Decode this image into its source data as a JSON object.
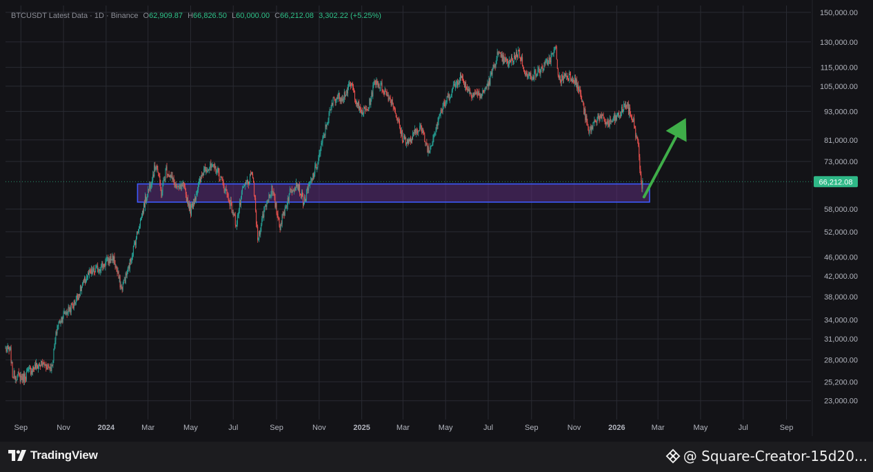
{
  "legend": {
    "symbol": "BTCUSDT Latest Data",
    "interval": "1D",
    "exchange": "Binance",
    "open_label": "O",
    "open": "62,909.87",
    "high_label": "H",
    "high": "66,826.50",
    "low_label": "L",
    "low": "60,000.00",
    "close_label": "C",
    "close": "66,212.08",
    "change": "3,302.22 (+5.25%)"
  },
  "colors": {
    "background": "#131317",
    "grid": "#2a2b33",
    "axis_text": "#b2b5be",
    "up": "#26a69a",
    "down": "#ef5350",
    "zone_fill": "#5b2d7a",
    "zone_border": "#3d5afe",
    "arrow": "#3fae49",
    "price_label_bg": "#2fb887"
  },
  "chart_data": {
    "type": "candlestick",
    "title": "BTCUSDT Latest Data · 1D · Binance",
    "y_scale": "log",
    "ylim": [
      21000,
      155000
    ],
    "grid": true,
    "x_ticks": [
      {
        "label": "Sep",
        "date": "2023-09-01",
        "bold": false
      },
      {
        "label": "Nov",
        "date": "2023-11-01",
        "bold": false
      },
      {
        "label": "2024",
        "date": "2024-01-01",
        "bold": true
      },
      {
        "label": "Mar",
        "date": "2024-03-01",
        "bold": false
      },
      {
        "label": "May",
        "date": "2024-05-01",
        "bold": false
      },
      {
        "label": "Jul",
        "date": "2024-07-01",
        "bold": false
      },
      {
        "label": "Sep",
        "date": "2024-09-01",
        "bold": false
      },
      {
        "label": "Nov",
        "date": "2024-11-01",
        "bold": false
      },
      {
        "label": "2025",
        "date": "2025-01-01",
        "bold": true
      },
      {
        "label": "Mar",
        "date": "2025-03-01",
        "bold": false
      },
      {
        "label": "May",
        "date": "2025-05-01",
        "bold": false
      },
      {
        "label": "Jul",
        "date": "2025-07-01",
        "bold": false
      },
      {
        "label": "Sep",
        "date": "2025-09-01",
        "bold": false
      },
      {
        "label": "Nov",
        "date": "2025-11-01",
        "bold": false
      },
      {
        "label": "2026",
        "date": "2026-01-01",
        "bold": true
      },
      {
        "label": "Mar",
        "date": "2026-03-01",
        "bold": false
      },
      {
        "label": "May",
        "date": "2026-05-01",
        "bold": false
      },
      {
        "label": "Jul",
        "date": "2026-07-01",
        "bold": false
      },
      {
        "label": "Sep",
        "date": "2026-09-01",
        "bold": false
      }
    ],
    "y_ticks": [
      {
        "label": "150,000.00",
        "value": 150000
      },
      {
        "label": "130,000.00",
        "value": 130000
      },
      {
        "label": "115,000.00",
        "value": 115000
      },
      {
        "label": "105,000.00",
        "value": 105000
      },
      {
        "label": "93,000.00",
        "value": 93000
      },
      {
        "label": "81,000.00",
        "value": 81000
      },
      {
        "label": "73,000.00",
        "value": 73000
      },
      {
        "label": "58,000.00",
        "value": 58000
      },
      {
        "label": "52,000.00",
        "value": 52000
      },
      {
        "label": "46,000.00",
        "value": 46000
      },
      {
        "label": "42,000.00",
        "value": 42000
      },
      {
        "label": "38,000.00",
        "value": 38000
      },
      {
        "label": "34,000.00",
        "value": 34000
      },
      {
        "label": "31,000.00",
        "value": 31000
      },
      {
        "label": "28,000.00",
        "value": 28000
      },
      {
        "label": "25,200.00",
        "value": 25200
      },
      {
        "label": "23,000.00",
        "value": 23000
      }
    ],
    "last_price": {
      "label": "66,212.08",
      "value": 66212.08
    },
    "price_path": [
      [
        "2023-08-10",
        29500
      ],
      [
        "2023-08-17",
        29200
      ],
      [
        "2023-08-20",
        26100
      ],
      [
        "2023-09-05",
        25700
      ],
      [
        "2023-09-12",
        26500
      ],
      [
        "2023-09-20",
        27000
      ],
      [
        "2023-10-01",
        27500
      ],
      [
        "2023-10-15",
        27000
      ],
      [
        "2023-10-23",
        33000
      ],
      [
        "2023-11-01",
        34800
      ],
      [
        "2023-11-15",
        36500
      ],
      [
        "2023-12-05",
        42000
      ],
      [
        "2023-12-20",
        43500
      ],
      [
        "2024-01-11",
        46000
      ],
      [
        "2024-01-23",
        39500
      ],
      [
        "2024-02-01",
        43000
      ],
      [
        "2024-02-15",
        52000
      ],
      [
        "2024-02-28",
        62000
      ],
      [
        "2024-03-13",
        72500
      ],
      [
        "2024-03-20",
        62500
      ],
      [
        "2024-03-27",
        70500
      ],
      [
        "2024-04-13",
        63500
      ],
      [
        "2024-04-20",
        65000
      ],
      [
        "2024-05-01",
        57500
      ],
      [
        "2024-05-21",
        71000
      ],
      [
        "2024-06-07",
        70500
      ],
      [
        "2024-06-25",
        61000
      ],
      [
        "2024-07-05",
        54000
      ],
      [
        "2024-07-15",
        64000
      ],
      [
        "2024-07-29",
        68500
      ],
      [
        "2024-08-05",
        50000
      ],
      [
        "2024-08-15",
        58500
      ],
      [
        "2024-08-25",
        64000
      ],
      [
        "2024-09-06",
        53500
      ],
      [
        "2024-09-20",
        63000
      ],
      [
        "2024-09-30",
        66000
      ],
      [
        "2024-10-10",
        60000
      ],
      [
        "2024-10-29",
        72000
      ],
      [
        "2024-11-12",
        88000
      ],
      [
        "2024-11-22",
        99000
      ],
      [
        "2024-12-05",
        100000
      ],
      [
        "2024-12-17",
        106000
      ],
      [
        "2024-12-30",
        92500
      ],
      [
        "2025-01-10",
        94000
      ],
      [
        "2025-01-20",
        108000
      ],
      [
        "2025-01-31",
        104000
      ],
      [
        "2025-02-15",
        96500
      ],
      [
        "2025-02-28",
        82000
      ],
      [
        "2025-03-10",
        80000
      ],
      [
        "2025-03-25",
        87000
      ],
      [
        "2025-04-07",
        76500
      ],
      [
        "2025-04-22",
        91500
      ],
      [
        "2025-05-10",
        103000
      ],
      [
        "2025-05-22",
        110000
      ],
      [
        "2025-06-05",
        102000
      ],
      [
        "2025-06-22",
        100500
      ],
      [
        "2025-07-03",
        108000
      ],
      [
        "2025-07-14",
        122000
      ],
      [
        "2025-07-30",
        117000
      ],
      [
        "2025-08-14",
        124000
      ],
      [
        "2025-08-25",
        110000
      ],
      [
        "2025-09-05",
        111000
      ],
      [
        "2025-09-20",
        115500
      ],
      [
        "2025-10-06",
        125500
      ],
      [
        "2025-10-10",
        108000
      ],
      [
        "2025-10-20",
        111000
      ],
      [
        "2025-11-01",
        109000
      ],
      [
        "2025-11-10",
        101000
      ],
      [
        "2025-11-22",
        84000
      ],
      [
        "2025-12-05",
        91000
      ],
      [
        "2025-12-20",
        87500
      ],
      [
        "2026-01-05",
        91500
      ],
      [
        "2026-01-14",
        96500
      ],
      [
        "2026-01-25",
        88500
      ],
      [
        "2026-02-01",
        78000
      ],
      [
        "2026-02-06",
        62909.87
      ],
      [
        "2026-02-07",
        66212.08
      ]
    ],
    "annotations": {
      "support_zone": {
        "label": "",
        "x_start": "2024-02-15",
        "x_end": "2026-02-17",
        "y_low": 60000,
        "y_high": 65500
      },
      "arrow": {
        "from": [
          "2026-02-09",
          61500
        ],
        "to": [
          "2026-04-10",
          90000
        ],
        "direction": "up"
      }
    }
  },
  "footer": {
    "brand": "TradingView",
    "creator": "@ Square-Creator-15d20..."
  }
}
